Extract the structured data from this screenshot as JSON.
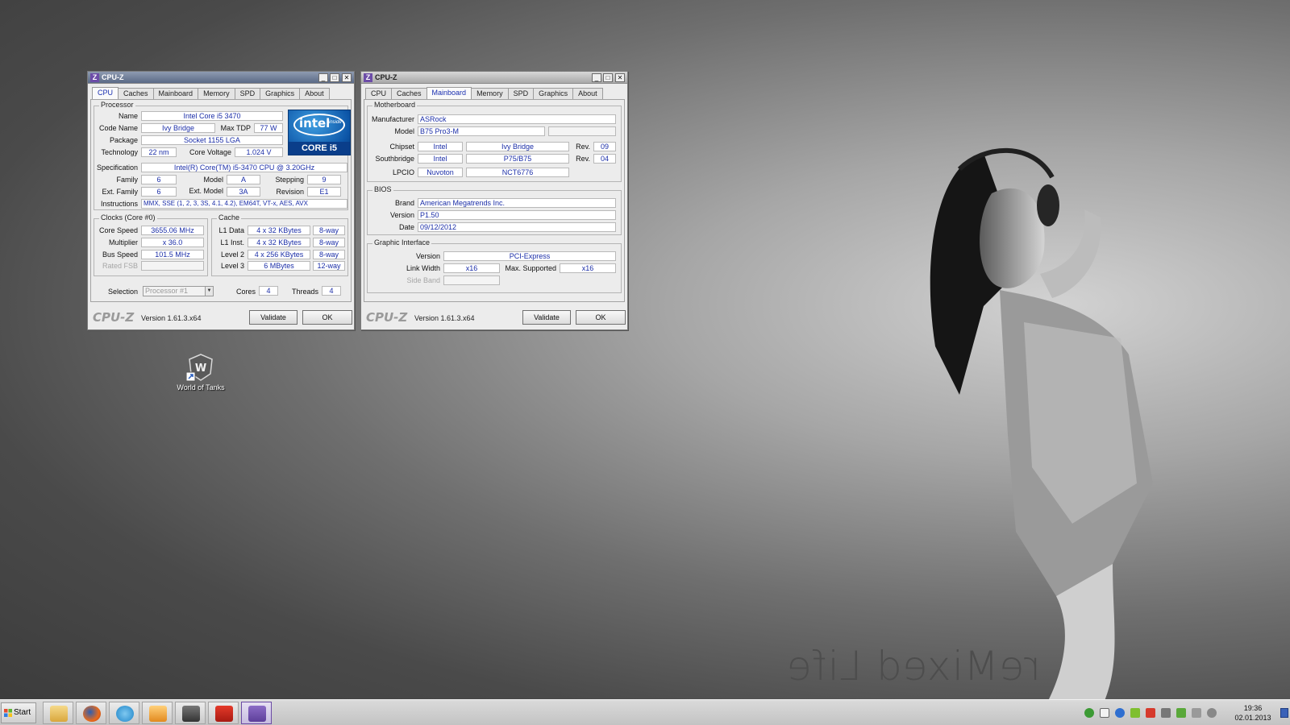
{
  "colors": {
    "accent_text": "#1b2ea8",
    "window_bg": "#ececec",
    "intel_blue": "#0d56a8",
    "cpuz_purple": "#6d4da8"
  },
  "wallpaper": {
    "text": "reMixed Life"
  },
  "cpuz_left": {
    "title": "CPU-Z",
    "tabs": [
      "CPU",
      "Caches",
      "Mainboard",
      "Memory",
      "SPD",
      "Graphics",
      "About"
    ],
    "active_tab": "CPU",
    "processor": {
      "group_label": "Processor",
      "name_label": "Name",
      "name": "Intel Core i5 3470",
      "code_name_label": "Code Name",
      "code_name": "Ivy Bridge",
      "max_tdp_label": "Max TDP",
      "max_tdp": "77 W",
      "package_label": "Package",
      "package": "Socket 1155 LGA",
      "technology_label": "Technology",
      "technology": "22 nm",
      "core_voltage_label": "Core Voltage",
      "core_voltage": "1.024 V",
      "specification_label": "Specification",
      "specification": "Intel(R) Core(TM) i5-3470 CPU @ 3.20GHz",
      "family_label": "Family",
      "family": "6",
      "model_label": "Model",
      "model": "A",
      "stepping_label": "Stepping",
      "stepping": "9",
      "ext_family_label": "Ext. Family",
      "ext_family": "6",
      "ext_model_label": "Ext. Model",
      "ext_model": "3A",
      "revision_label": "Revision",
      "revision": "E1",
      "instructions_label": "Instructions",
      "instructions": "MMX, SSE (1, 2, 3, 3S, 4.1, 4.2), EM64T, VT-x, AES, AVX",
      "logo_word": "intel",
      "logo_inside": "inside",
      "logo_core": "CORE i5"
    },
    "clocks": {
      "group_label": "Clocks (Core #0)",
      "core_speed_label": "Core Speed",
      "core_speed": "3655.06 MHz",
      "multiplier_label": "Multiplier",
      "multiplier": "x 36.0",
      "bus_speed_label": "Bus Speed",
      "bus_speed": "101.5 MHz",
      "rated_fsb_label": "Rated FSB",
      "rated_fsb": ""
    },
    "cache": {
      "group_label": "Cache",
      "l1_data_label": "L1 Data",
      "l1_data": "4 x 32 KBytes",
      "l1_data_way": "8-way",
      "l1_inst_label": "L1 Inst.",
      "l1_inst": "4 x 32 KBytes",
      "l1_inst_way": "8-way",
      "level2_label": "Level 2",
      "level2": "4 x 256 KBytes",
      "level2_way": "8-way",
      "level3_label": "Level 3",
      "level3": "6 MBytes",
      "level3_way": "12-way"
    },
    "selection": {
      "label": "Selection",
      "value": "Processor #1",
      "cores_label": "Cores",
      "cores": "4",
      "threads_label": "Threads",
      "threads": "4"
    },
    "footer": {
      "brand": "CPU-Z",
      "version": "Version 1.61.3.x64",
      "validate": "Validate",
      "ok": "OK"
    }
  },
  "cpuz_right": {
    "title": "CPU-Z",
    "tabs": [
      "CPU",
      "Caches",
      "Mainboard",
      "Memory",
      "SPD",
      "Graphics",
      "About"
    ],
    "active_tab": "Mainboard",
    "motherboard": {
      "group_label": "Motherboard",
      "manufacturer_label": "Manufacturer",
      "manufacturer": "ASRock",
      "model_label": "Model",
      "model": "B75 Pro3-M",
      "chipset_label": "Chipset",
      "chipset_vendor": "Intel",
      "chipset_name": "Ivy Bridge",
      "chipset_rev_label": "Rev.",
      "chipset_rev": "09",
      "southbridge_label": "Southbridge",
      "southbridge_vendor": "Intel",
      "southbridge_name": "P75/B75",
      "southbridge_rev_label": "Rev.",
      "southbridge_rev": "04",
      "lpcio_label": "LPCIO",
      "lpcio_vendor": "Nuvoton",
      "lpcio_name": "NCT6776"
    },
    "bios": {
      "group_label": "BIOS",
      "brand_label": "Brand",
      "brand": "American Megatrends Inc.",
      "version_label": "Version",
      "version": "P1.50",
      "date_label": "Date",
      "date": "09/12/2012"
    },
    "graphic": {
      "group_label": "Graphic Interface",
      "version_label": "Version",
      "version": "PCI-Express",
      "link_width_label": "Link Width",
      "link_width": "x16",
      "max_supported_label": "Max. Supported",
      "max_supported": "x16",
      "side_band_label": "Side Band",
      "side_band": ""
    },
    "footer": {
      "brand": "CPU-Z",
      "version": "Version 1.61.3.x64",
      "validate": "Validate",
      "ok": "OK"
    }
  },
  "desktop_icon": {
    "label": "World of Tanks"
  },
  "taskbar": {
    "start_label": "Start",
    "pinned": [
      "explorer-icon",
      "firefox-icon",
      "skype-icon",
      "media-player-icon",
      "world-of-tanks-icon",
      "acrobat-icon",
      "cpuz-icon"
    ],
    "clock_time": "19:36",
    "clock_date": "02.01.2013"
  }
}
